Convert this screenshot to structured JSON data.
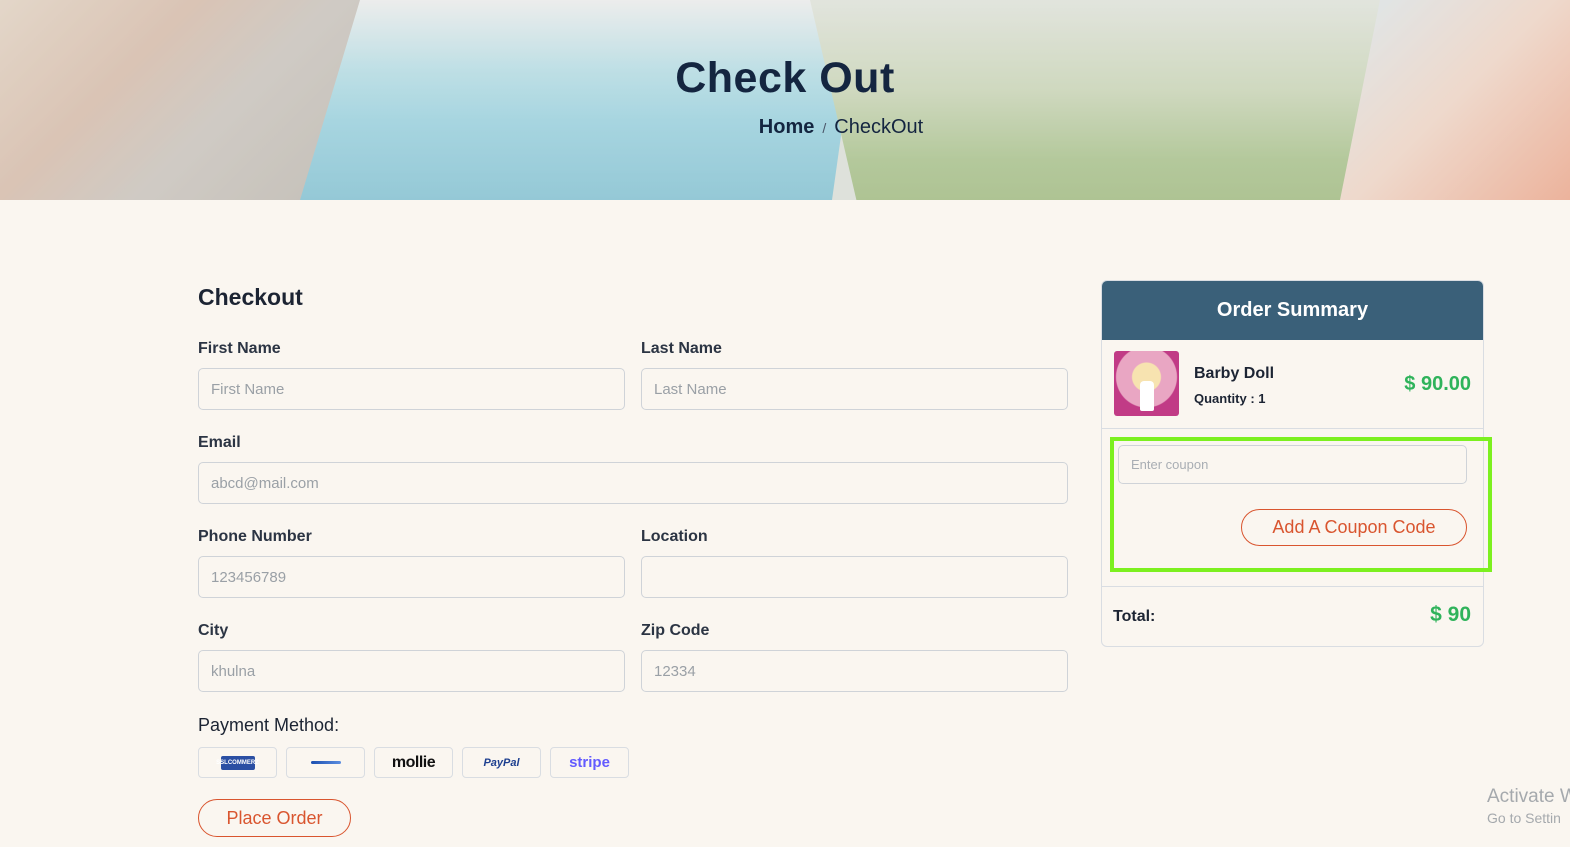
{
  "hero": {
    "title": "Check Out",
    "breadcrumb_home": "Home",
    "breadcrumb_separator": "/",
    "breadcrumb_current": "CheckOut"
  },
  "form": {
    "title": "Checkout",
    "first_name": {
      "label": "First Name",
      "placeholder": "First Name",
      "value": ""
    },
    "last_name": {
      "label": "Last Name",
      "placeholder": "Last Name",
      "value": ""
    },
    "email": {
      "label": "Email",
      "placeholder": "abcd@mail.com",
      "value": ""
    },
    "phone": {
      "label": "Phone Number",
      "placeholder": "123456789",
      "value": ""
    },
    "location": {
      "label": "Location",
      "placeholder": "",
      "value": ""
    },
    "city": {
      "label": "City",
      "placeholder": "khulna",
      "value": ""
    },
    "zip": {
      "label": "Zip Code",
      "placeholder": "12334",
      "value": ""
    },
    "payment_label": "Payment Method:",
    "payment_methods": [
      {
        "name": "sslcommerz",
        "text": "SSLCOMMERZ"
      },
      {
        "name": "flutterwave",
        "text": ""
      },
      {
        "name": "mollie",
        "text": "mollie"
      },
      {
        "name": "paypal",
        "text": "PayPal"
      },
      {
        "name": "stripe",
        "text": "stripe"
      }
    ],
    "place_order_label": "Place Order"
  },
  "summary": {
    "title": "Order Summary",
    "item": {
      "name": "Barby Doll",
      "quantity_text": "Quantity : 1",
      "price": "$ 90.00"
    },
    "coupon_placeholder": "Enter coupon",
    "coupon_button_label": "Add A Coupon Code",
    "total_label": "Total:",
    "total_value": "$ 90"
  },
  "overlay": {
    "watermark_line1": "Activate W",
    "watermark_line2": "Go to Settin"
  },
  "colors": {
    "background": "#faf6f0",
    "summary_header": "#3a6079",
    "accent_orange": "#d9552f",
    "price_green": "#2fb35b",
    "highlight_green": "#7cf01f"
  }
}
